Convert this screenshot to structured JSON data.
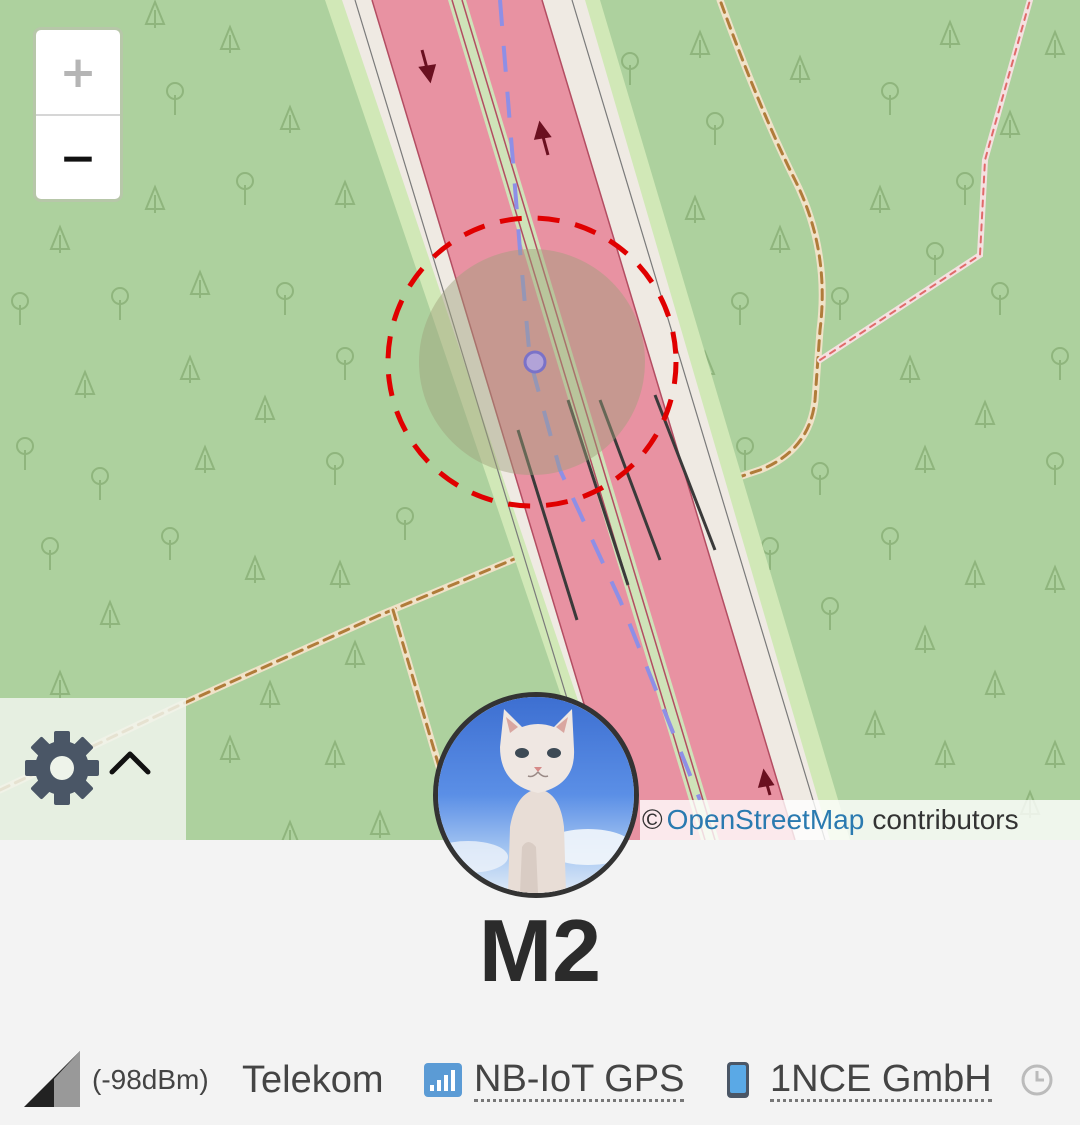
{
  "map": {
    "zoom_in_label": "+",
    "zoom_out_label": "−",
    "attribution": {
      "prefix": "©",
      "link": "OpenStreetMap",
      "suffix": "contributors"
    },
    "colors": {
      "forest": "#add19e",
      "road": "#e892a2",
      "accuracy_ring": "#e00000",
      "track": "#8e8fe6"
    }
  },
  "device": {
    "name": "M2",
    "avatar": "white-kitten-photo"
  },
  "status_bar": {
    "signal_strength": "(-98dBm)",
    "operator": "Telekom",
    "network_mode": "NB-IoT GPS",
    "sim_provider": "1NCE GmbH",
    "icons": [
      "signal-icon",
      "network-bars-icon",
      "phone-icon",
      "clock-icon"
    ]
  }
}
